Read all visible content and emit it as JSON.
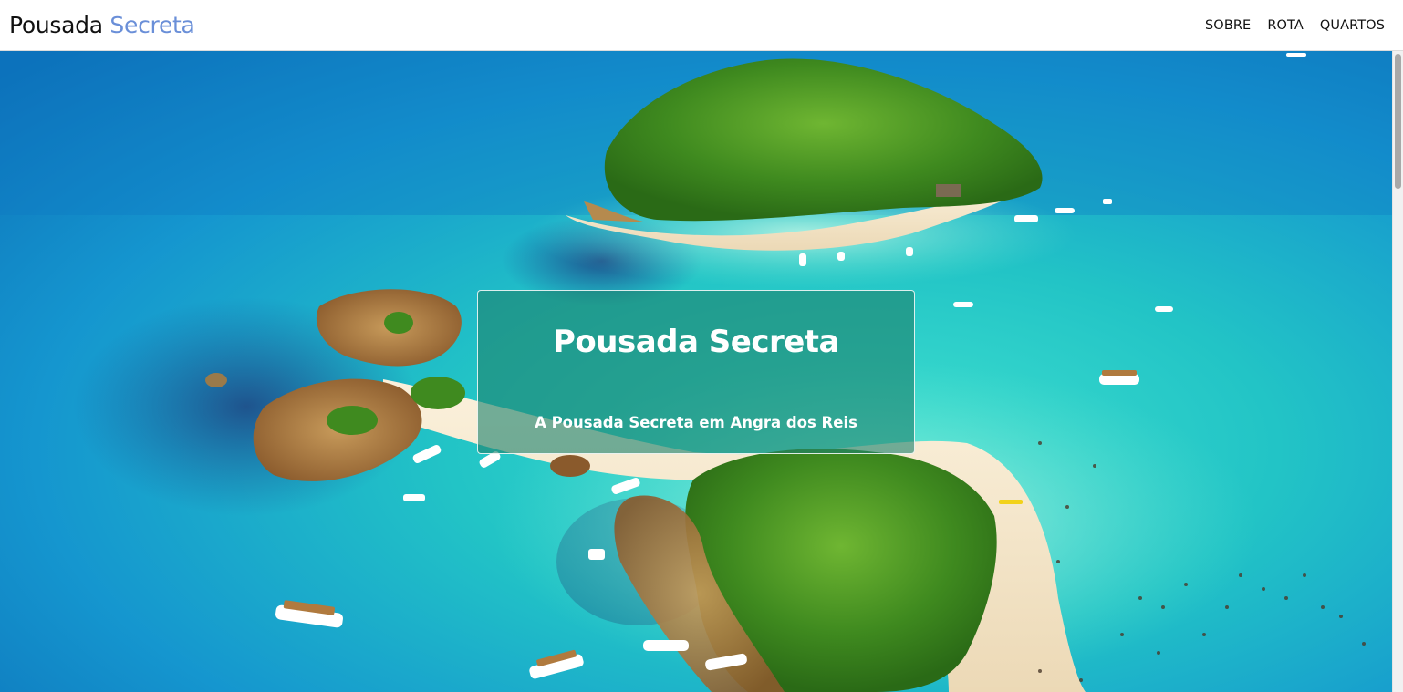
{
  "navbar": {
    "brand_primary": "Pousada",
    "brand_accent": "Secreta",
    "links": [
      {
        "label": "SOBRE"
      },
      {
        "label": "ROTA"
      },
      {
        "label": "QUARTOS"
      }
    ]
  },
  "hero": {
    "image_icon": "aerial-island-photo-icon",
    "caption_title": "Pousada Secreta",
    "caption_subtitle": "A Pousada Secreta em Angra dos Reis"
  },
  "colors": {
    "brand_accent": "#6a8fd8",
    "caption_bg": "#1e826e",
    "sea_deep": "#0f7fc4",
    "sea_turquoise": "#22c7c2",
    "vegetation": "#3f8a1f",
    "sand": "#f3e6cf"
  }
}
